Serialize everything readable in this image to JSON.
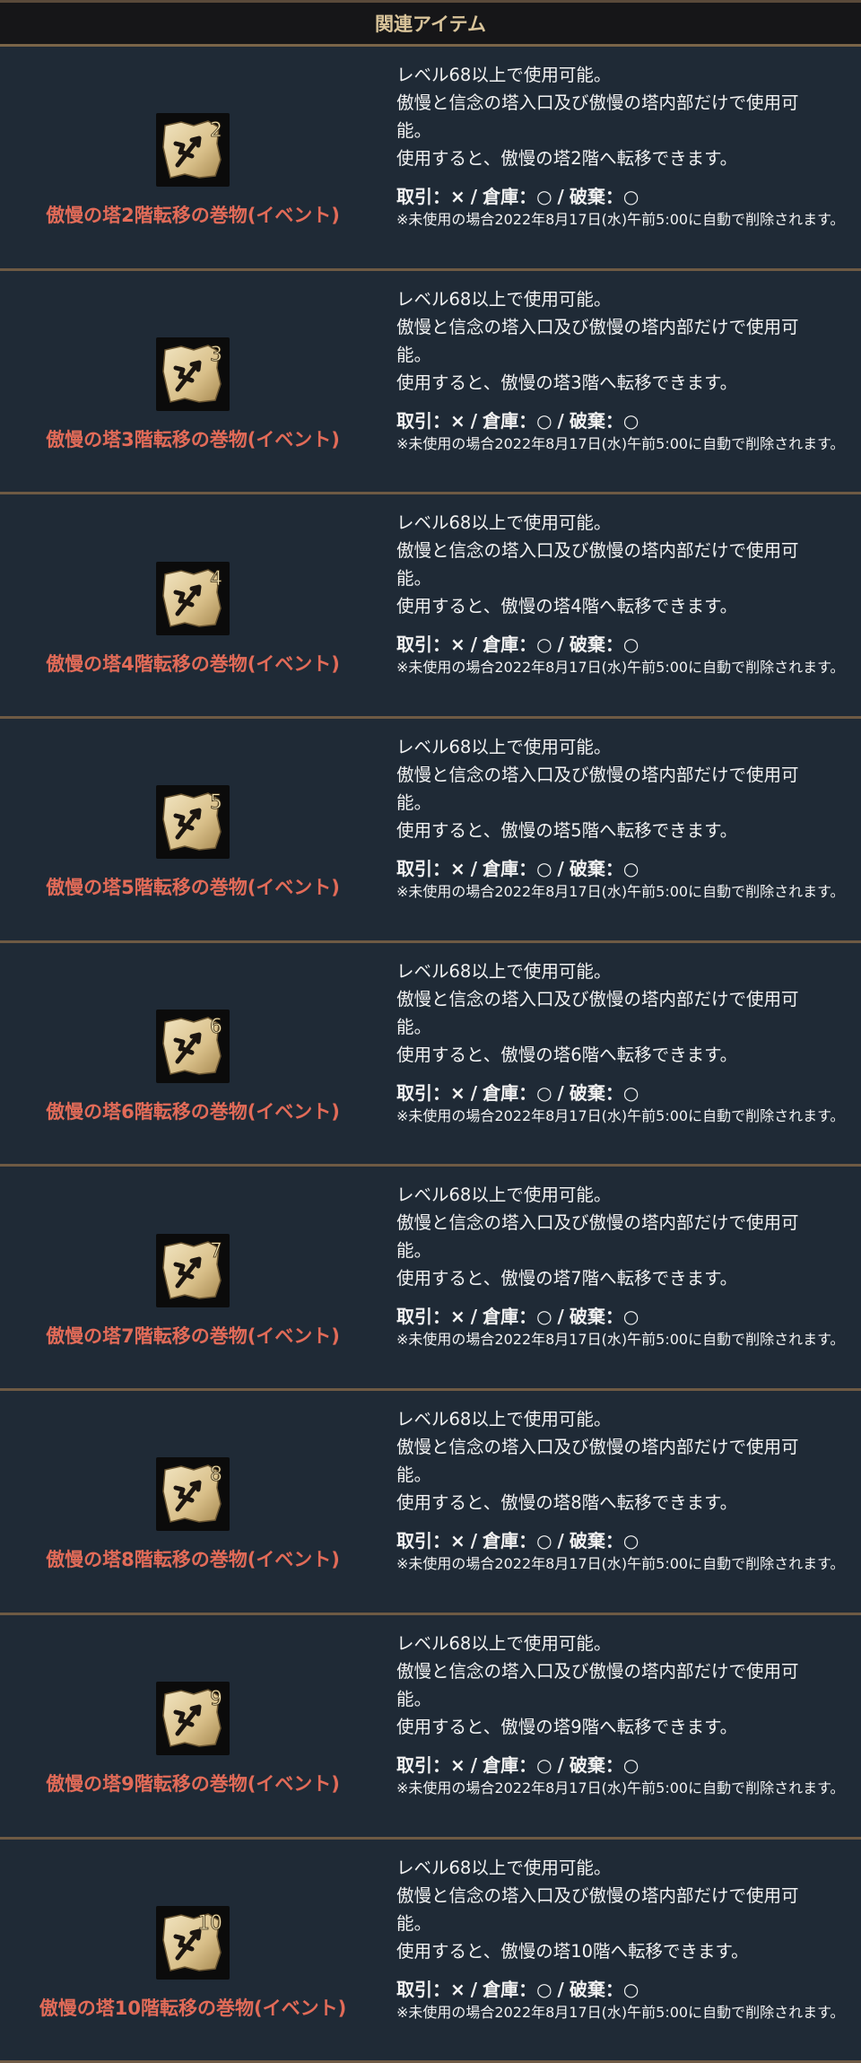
{
  "header": {
    "title": "関連アイテム"
  },
  "common": {
    "line1": "レベル68以上で使用可能。",
    "line2": "傲慢と信念の塔入口及び傲慢の塔内部だけで使用可",
    "line2b": "能。",
    "trade_label": "取引：×",
    "storage_label": "倉庫：○",
    "discard_label": "破棄：○",
    "sep": "/",
    "note": "※未使用の場合2022年8月17日(水)午前5:00に自動で削除されます。"
  },
  "items": [
    {
      "num": "2",
      "name": "傲慢の塔2階転移の巻物(イベント)",
      "use": "使用すると、傲慢の塔2階へ転移できます。"
    },
    {
      "num": "3",
      "name": "傲慢の塔3階転移の巻物(イベント)",
      "use": "使用すると、傲慢の塔3階へ転移できます。"
    },
    {
      "num": "4",
      "name": "傲慢の塔4階転移の巻物(イベント)",
      "use": "使用すると、傲慢の塔4階へ転移できます。"
    },
    {
      "num": "5",
      "name": "傲慢の塔5階転移の巻物(イベント)",
      "use": "使用すると、傲慢の塔5階へ転移できます。"
    },
    {
      "num": "6",
      "name": "傲慢の塔6階転移の巻物(イベント)",
      "use": "使用すると、傲慢の塔6階へ転移できます。"
    },
    {
      "num": "7",
      "name": "傲慢の塔7階転移の巻物(イベント)",
      "use": "使用すると、傲慢の塔7階へ転移できます。"
    },
    {
      "num": "8",
      "name": "傲慢の塔8階転移の巻物(イベント)",
      "use": "使用すると、傲慢の塔8階へ転移できます。"
    },
    {
      "num": "9",
      "name": "傲慢の塔9階転移の巻物(イベント)",
      "use": "使用すると、傲慢の塔9階へ転移できます。"
    },
    {
      "num": "10",
      "name": "傲慢の塔10階転移の巻物(イベント)",
      "use": "使用すると、傲慢の塔10階へ転移できます。"
    }
  ],
  "colors": {
    "background": "#1f2833",
    "header_bg": "#161618",
    "header_text": "#d9c49a",
    "item_name": "#e26b58",
    "divider": "#6e5a44"
  },
  "icons": {
    "item_icon": "scroll-icon"
  }
}
